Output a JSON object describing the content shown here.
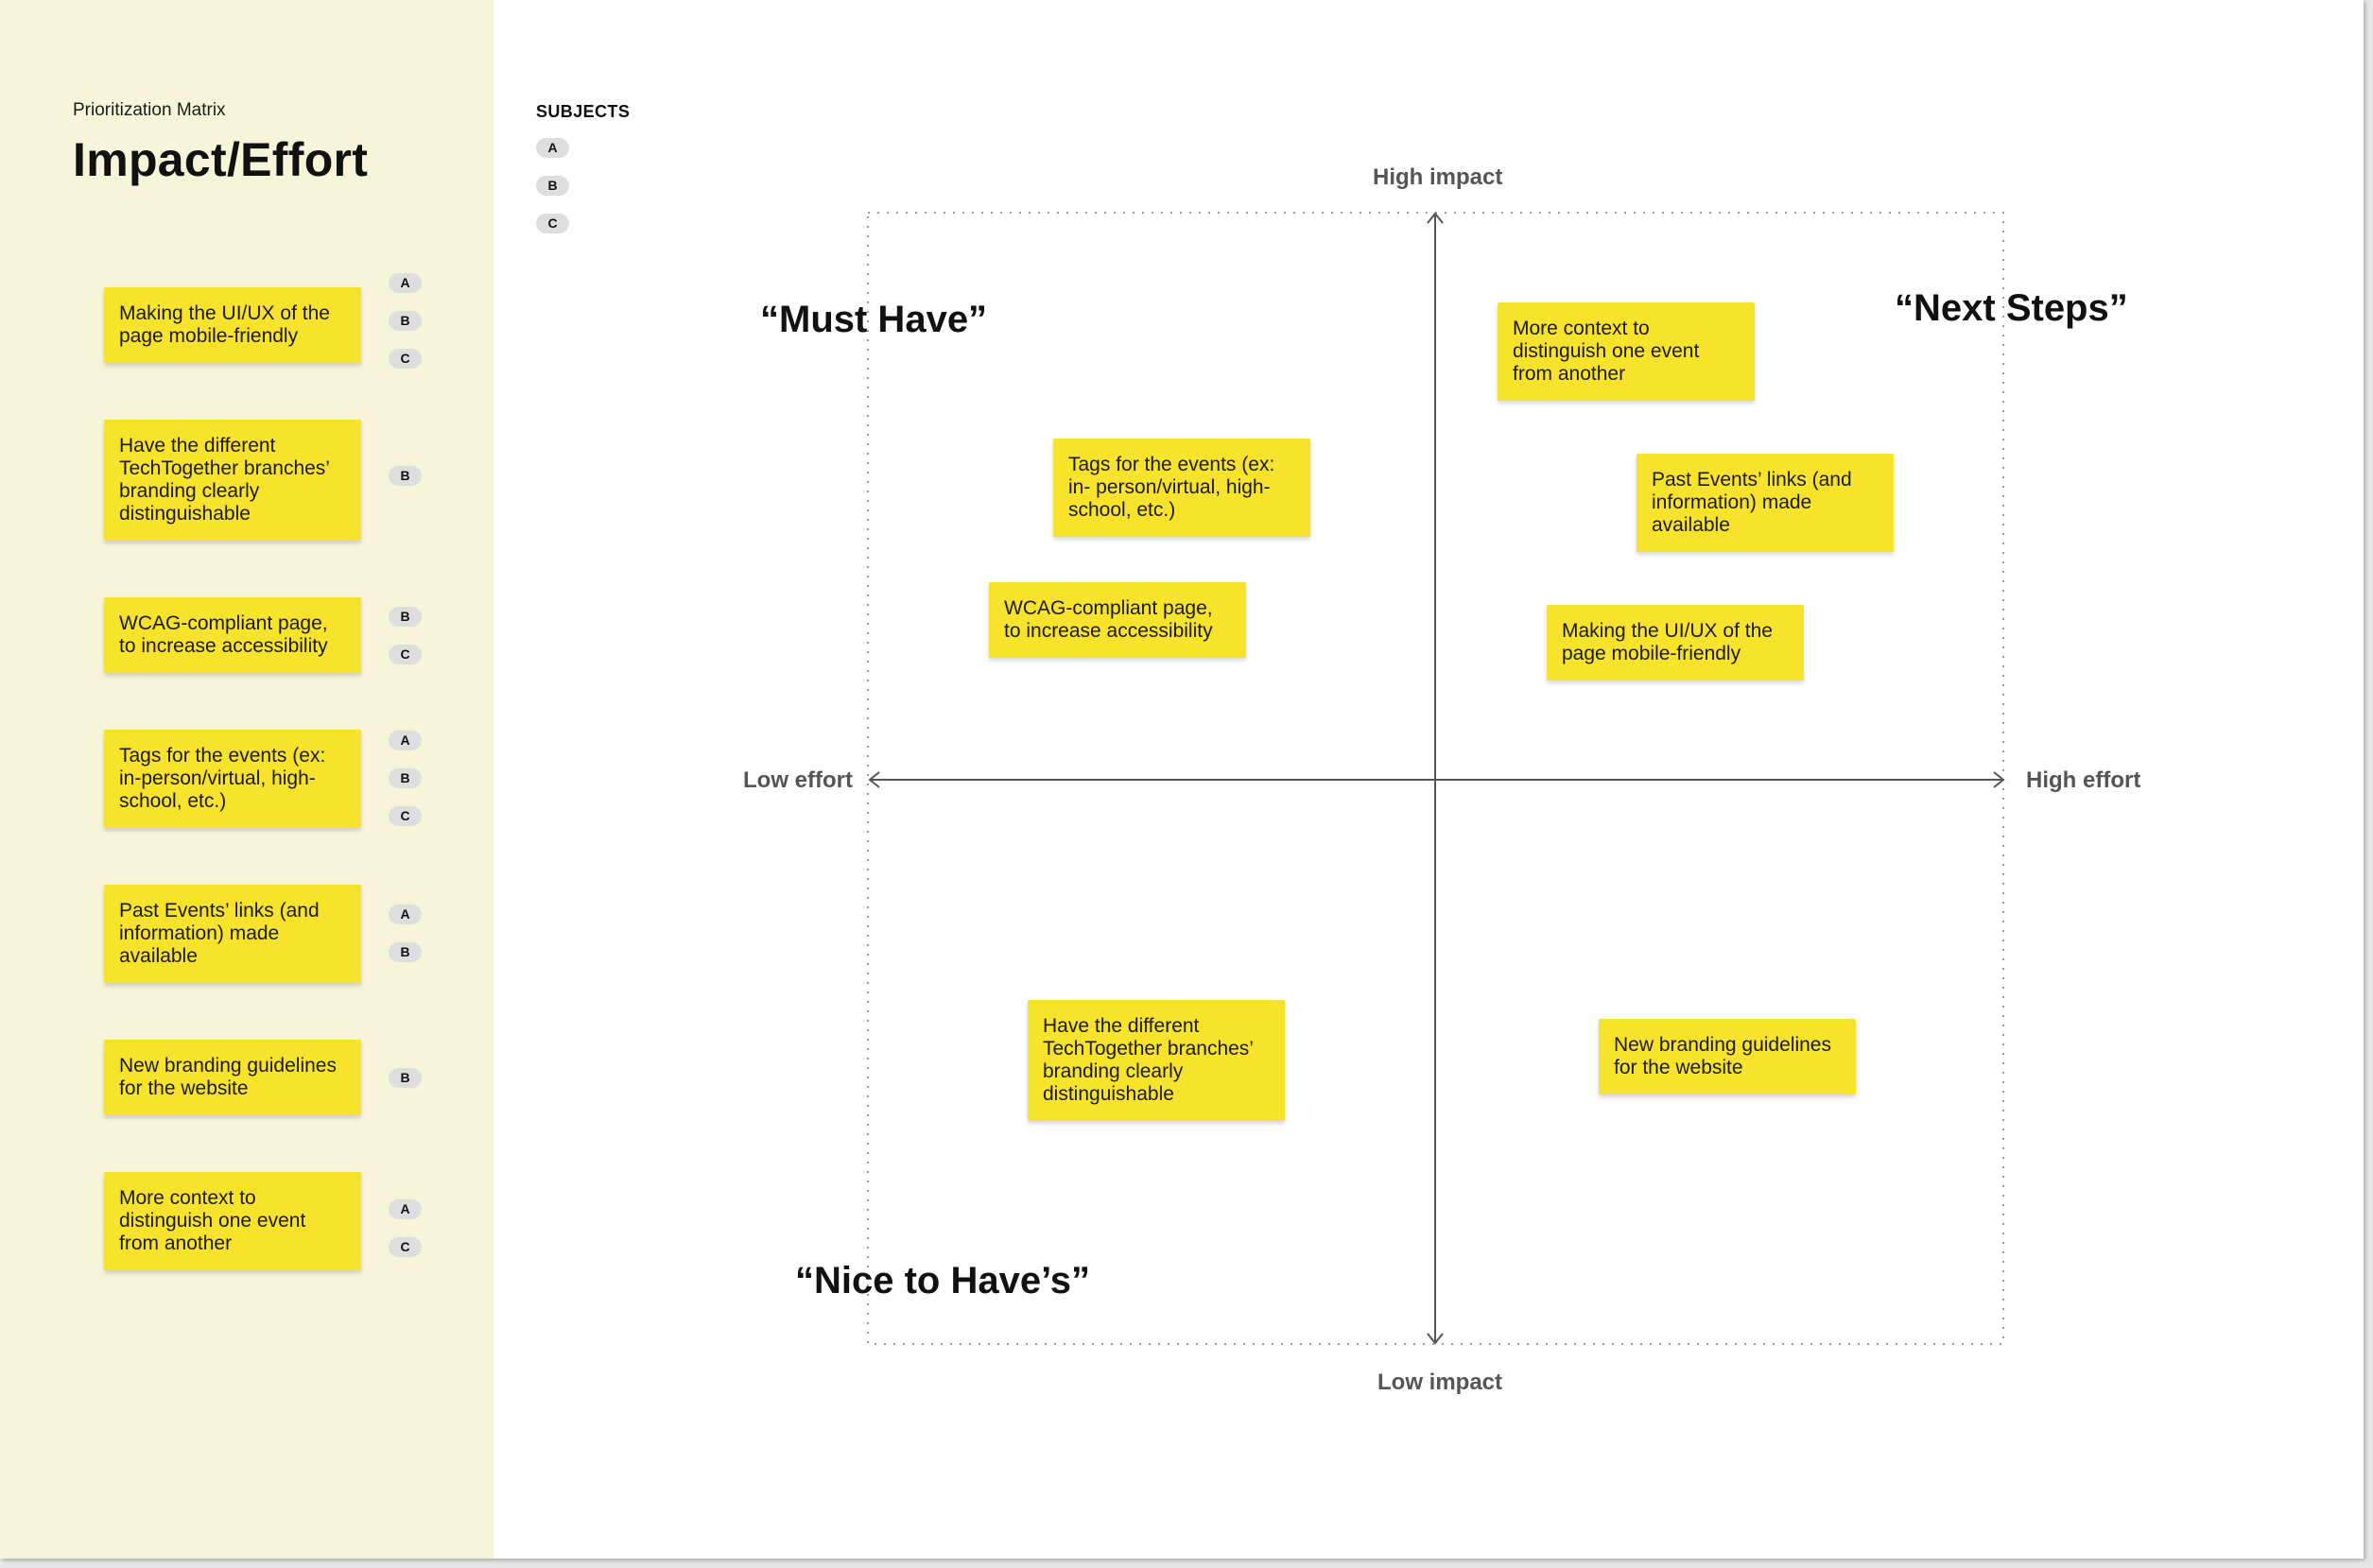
{
  "header": {
    "eyebrow": "Prioritization Matrix",
    "title": "Impact/Effort"
  },
  "sidebar": {
    "items": [
      {
        "text": "Making the UI/UX of the page mobile-friendly",
        "subjects": [
          "A",
          "B",
          "C"
        ]
      },
      {
        "text": "Have the different TechTogether branches’ branding clearly distinguishable",
        "subjects": [
          "B"
        ]
      },
      {
        "text": "WCAG-compliant page, to increase accessibility",
        "subjects": [
          "B",
          "C"
        ]
      },
      {
        "text": "Tags for the events (ex: in-person/virtual, high-school, etc.)",
        "subjects": [
          "A",
          "B",
          "C"
        ]
      },
      {
        "text": "Past Events’ links (and information) made available",
        "subjects": [
          "A",
          "B"
        ]
      },
      {
        "text": "New branding guidelines for the website",
        "subjects": [
          "B"
        ]
      },
      {
        "text": "More context to distinguish one event from another",
        "subjects": [
          "A",
          "C"
        ]
      }
    ]
  },
  "subjects": {
    "title": "SUBJECTS",
    "items": [
      "A",
      "B",
      "C"
    ]
  },
  "matrix": {
    "axes": {
      "top": "High impact",
      "bottom": "Low impact",
      "left": "Low effort",
      "right": "High effort"
    },
    "quadrants": {
      "top_left": "“Must Have”",
      "top_right": "“Next Steps”",
      "bottom_left": "“Nice to Have’s”"
    },
    "stickies": [
      {
        "text": "More context to distinguish one event from another"
      },
      {
        "text": "Tags for the events (ex: in- person/virtual, high-school, etc.)"
      },
      {
        "text": "Past Events’ links (and information) made available"
      },
      {
        "text": "WCAG-compliant page, to increase accessibility"
      },
      {
        "text": "Making the UI/UX of the page mobile-friendly"
      },
      {
        "text": "Have the different TechTogether branches’ branding clearly distinguishable"
      },
      {
        "text": "New branding guidelines for the website"
      }
    ]
  },
  "colors": {
    "sidebar_bg": "#f7f5d9",
    "sticky": "#f7e22c",
    "badge": "#dedede",
    "axis": "#555555"
  }
}
